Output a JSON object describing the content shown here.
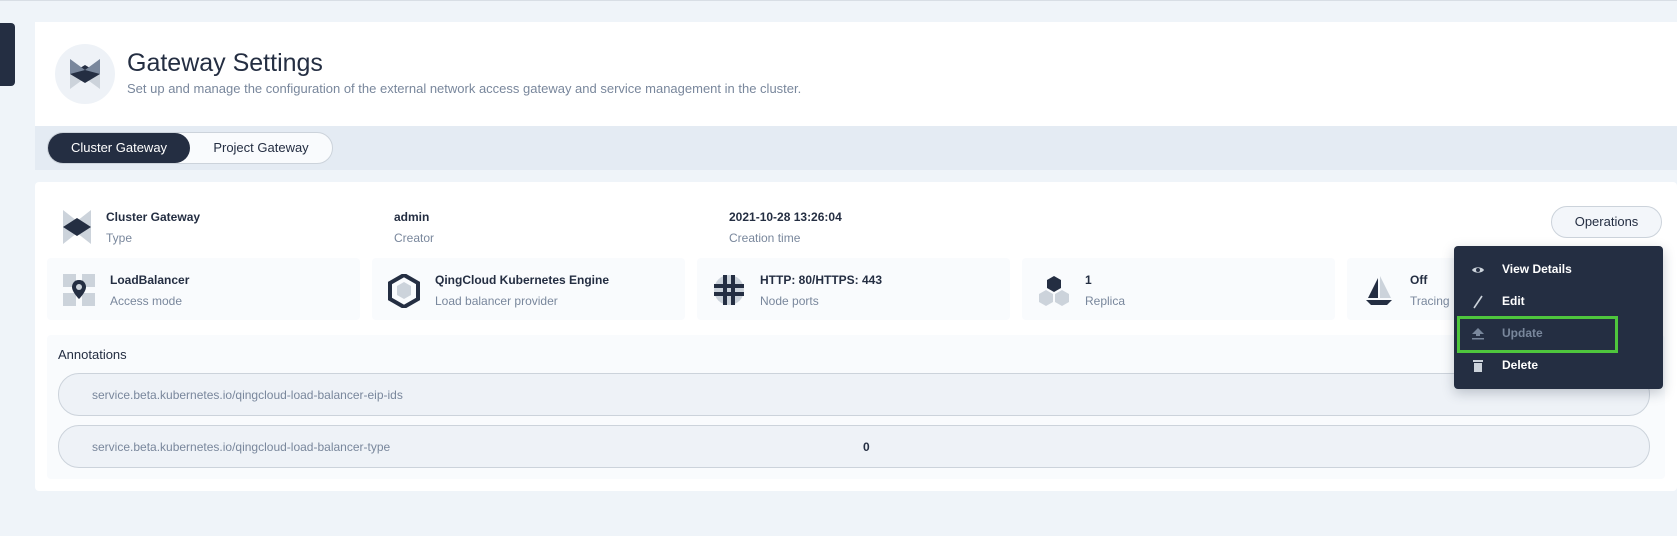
{
  "header": {
    "title": "Gateway Settings",
    "description": "Set up and manage the configuration of the external network access gateway and service management in the cluster.",
    "icon": "gateway-icon"
  },
  "tabs": [
    {
      "label": "Cluster Gateway",
      "active": true
    },
    {
      "label": "Project Gateway",
      "active": false
    }
  ],
  "gateway": {
    "type_value": "Cluster Gateway",
    "type_label": "Type",
    "creator_value": "admin",
    "creator_label": "Creator",
    "created_value": "2021-10-28 13:26:04",
    "created_label": "Creation time",
    "operations_label": "Operations"
  },
  "tiles": [
    {
      "value": "LoadBalancer",
      "label": "Access mode",
      "icon": "location-pin-icon"
    },
    {
      "value": "QingCloud Kubernetes Engine",
      "label": "Load balancer provider",
      "icon": "qingcloud-icon"
    },
    {
      "value": "HTTP: 80/HTTPS: 443",
      "label": "Node ports",
      "icon": "globe-icon"
    },
    {
      "value": "1",
      "label": "Replica",
      "icon": "replica-icon"
    },
    {
      "value": "Off",
      "label": "Tracing",
      "icon": "sailboat-icon"
    }
  ],
  "annotations": {
    "title": "Annotations",
    "rows": [
      {
        "key": "service.beta.kubernetes.io/qingcloud-load-balancer-eip-ids",
        "value": ""
      },
      {
        "key": "service.beta.kubernetes.io/qingcloud-load-balancer-type",
        "value": "0"
      }
    ]
  },
  "menu": {
    "items": [
      {
        "label": "View Details",
        "icon": "eye-icon",
        "disabled": false
      },
      {
        "label": "Edit",
        "icon": "pen-icon",
        "disabled": false
      },
      {
        "label": "Update",
        "icon": "upload-icon",
        "disabled": true,
        "highlighted": true
      },
      {
        "label": "Delete",
        "icon": "trash-icon",
        "disabled": false
      }
    ]
  },
  "colors": {
    "primary_dark": "#242e42",
    "muted_text": "#79879c",
    "page_bg": "#eff4f9",
    "highlight": "#4ec63d"
  }
}
